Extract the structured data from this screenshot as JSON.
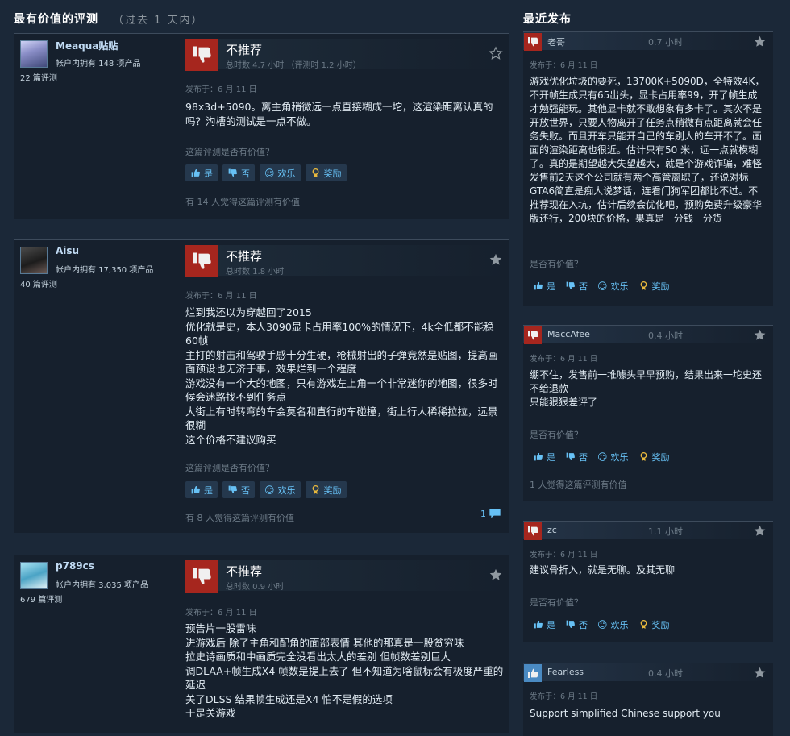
{
  "most_helpful": {
    "title": "最有价值的评测",
    "subtitle": "（过去 1 天内）",
    "reviews": [
      {
        "author": "Meaqua贴贴",
        "products": "帐户内拥有 148 项产品",
        "reviews_count": "22 篇评测",
        "verdict": "不推荐",
        "hours": "总时数 4.7 小时 （评测时 1.2 小时）",
        "posted": "发布于：6 月 11 日",
        "content": "98x3d+5090。离主角稍微远一点直接糊成一坨，这渲染距离认真的吗？沟槽的测试是一点不做。",
        "helpful_question": "这篇评测是否有价值？",
        "yes": "是",
        "no": "否",
        "funny": "欢乐",
        "award": "奖励",
        "helpful_count": "有 14 人觉得这篇评测有价值"
      },
      {
        "author": "Aisu",
        "products": "帐户内拥有 17,350 项产品",
        "reviews_count": "40 篇评测",
        "verdict": "不推荐",
        "hours": "总时数 1.8 小时",
        "posted": "发布于：6 月 11 日",
        "content": "烂到我还以为穿越回了2015\n优化就是史，本人3090显卡占用率100%的情况下，4k全低都不能稳60帧\n主打的射击和驾驶手感十分生硬，枪械射出的子弹竟然是贴图，提高画面预设也无济于事，效果烂到一个程度\n游戏没有一个大的地图，只有游戏左上角一个非常迷你的地图，很多时候会迷路找不到任务点\n大街上有时转弯的车会莫名和直行的车碰撞，街上行人稀稀拉拉，远景很糊\n这个价格不建议购买",
        "helpful_question": "这篇评测是否有价值？",
        "yes": "是",
        "no": "否",
        "funny": "欢乐",
        "award": "奖励",
        "helpful_count": "有 8 人觉得这篇评测有价值",
        "comments": "1"
      },
      {
        "author": "p789cs",
        "products": "帐户内拥有 3,035 项产品",
        "reviews_count": "679 篇评测",
        "verdict": "不推荐",
        "hours": "总时数 0.9 小时",
        "posted": "发布于：6 月 11 日",
        "content": "预告片一股雷味\n进游戏后 除了主角和配角的面部表情 其他的那真是一股贫穷味\n拉史诗画质和中画质完全没看出太大的差别 但帧数差别巨大\n调DLAA+帧生成X4 帧数是提上去了 但不知道为啥鼠标会有极度严重的延迟\n关了DLSS 结果帧生成还是X4 怕不是假的选项\n于是关游戏"
      }
    ]
  },
  "recent": {
    "title": "最近发布",
    "reviews": [
      {
        "author": "老哥",
        "hours": "0.7 小时",
        "recommend": false,
        "posted": "发布于：6 月 11 日",
        "content": "游戏优化垃圾的要死，13700K+5090D，全特效4K，不开帧生成只有65出头，显卡占用率99，开了帧生成才勉强能玩。其他显卡就不敢想象有多卡了。其次不是开放世界，只要人物离开了任务点稍微有点距离就会任务失败。而且开车只能开自己的车别人的车开不了。画面的渲染距离也很近。估计只有50 米，远一点就模糊了。真的是期望越大失望越大，就是个游戏诈骗，难怪发售前2天这个公司就有两个高管离职了，还说对标GTA6简直是痴人说梦话，连看门狗军团都比不过。不推荐现在入坑，估计后续会优化吧，预购免费升级豪华版还行，200块的价格，果真是一分钱一分货",
        "helpful_question": "是否有价值？",
        "yes": "是",
        "no": "否",
        "funny": "欢乐",
        "award": "奖励"
      },
      {
        "author": "MaccAfee",
        "hours": "0.4 小时",
        "recommend": false,
        "posted": "发布于：6 月 11 日",
        "content": "绷不住，发售前一堆噱头早早预购，结果出来一坨史还不给退款\n只能狠狠差评了",
        "helpful_question": "是否有价值？",
        "yes": "是",
        "no": "否",
        "funny": "欢乐",
        "award": "奖励",
        "helpful_count": "1 人觉得这篇评测有价值"
      },
      {
        "author": "zc",
        "hours": "1.1 小时",
        "recommend": false,
        "posted": "发布于：6 月 11 日",
        "content": "建议骨折入，就是无聊。及其无聊",
        "helpful_question": "是否有价值？",
        "yes": "是",
        "no": "否",
        "funny": "欢乐",
        "award": "奖励"
      },
      {
        "author": "Fearless",
        "hours": "0.4 小时",
        "recommend": true,
        "posted": "发布于：6 月 11 日",
        "content": "Support simplified Chinese support you"
      }
    ]
  }
}
